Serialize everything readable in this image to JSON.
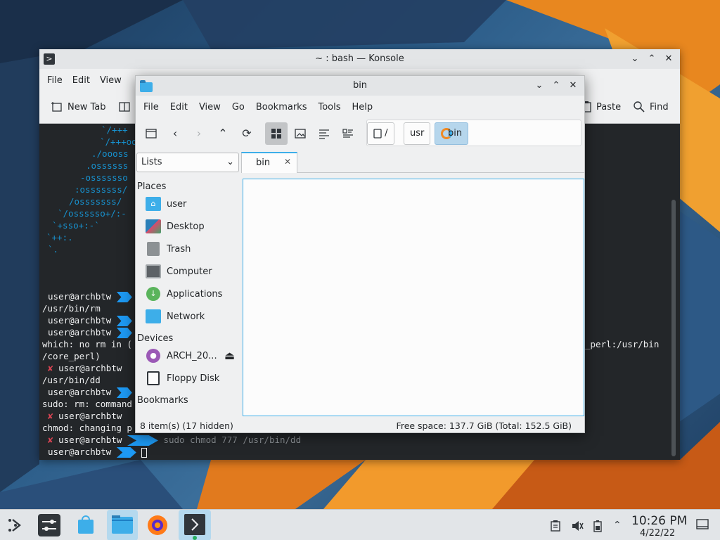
{
  "konsole": {
    "title": "~ : bash — Konsole",
    "menu": [
      "File",
      "Edit",
      "View"
    ],
    "toolbar": {
      "new_tab": "New Tab",
      "paste": "Paste",
      "find": "Find"
    },
    "logo_lines": [
      "`/+++ ",
      "`/+++oo",
      "./oooss",
      ".ossssss",
      "-osssssso",
      ":osssssss/",
      "/osssssss/",
      "`/ossssso+/:-",
      "`+sso+:-`",
      "`++:.",
      "`."
    ],
    "terminal_lines": {
      "l1_user": "user@archbtw",
      "l2": "/usr/bin/rm",
      "l3_user": "user@archbtw",
      "l4_user": "user@archbtw",
      "l5": "which: no rm in (",
      "l5_right": "_perl:/usr/bin",
      "l6": "/core_perl)",
      "l7_user": "user@archbtw",
      "l8": "/usr/bin/dd",
      "l9_user": "user@archbtw",
      "l10": "sudo: rm: command",
      "l11_user": "user@archbtw",
      "l12": "chmod: changing p",
      "l13_user": "user@archbtw",
      "l13_cmd": "sudo chmod 777 /usr/bin/dd",
      "l14_user": "user@archbtw",
      "x_mark": "✘",
      "tilde": "~"
    }
  },
  "dolphin": {
    "title": "bin",
    "menu": [
      "File",
      "Edit",
      "View",
      "Go",
      "Bookmarks",
      "Tools",
      "Help"
    ],
    "breadcrumbs": [
      "/",
      "usr",
      "bin"
    ],
    "panel_mode": "Lists",
    "tab_label": "bin",
    "places_heading": "Places",
    "places": [
      "user",
      "Desktop",
      "Trash",
      "Computer",
      "Applications",
      "Network"
    ],
    "devices_heading": "Devices",
    "devices": [
      "ARCH_20...",
      "Floppy Disk"
    ],
    "bookmarks_heading": "Bookmarks",
    "status_items": "8 item(s) (17 hidden)",
    "status_space": "Free space: 137.7 GiB (Total: 152.5 GiB)"
  },
  "taskbar": {
    "clock_time": "10:26 PM",
    "clock_date": "4/22/22"
  }
}
